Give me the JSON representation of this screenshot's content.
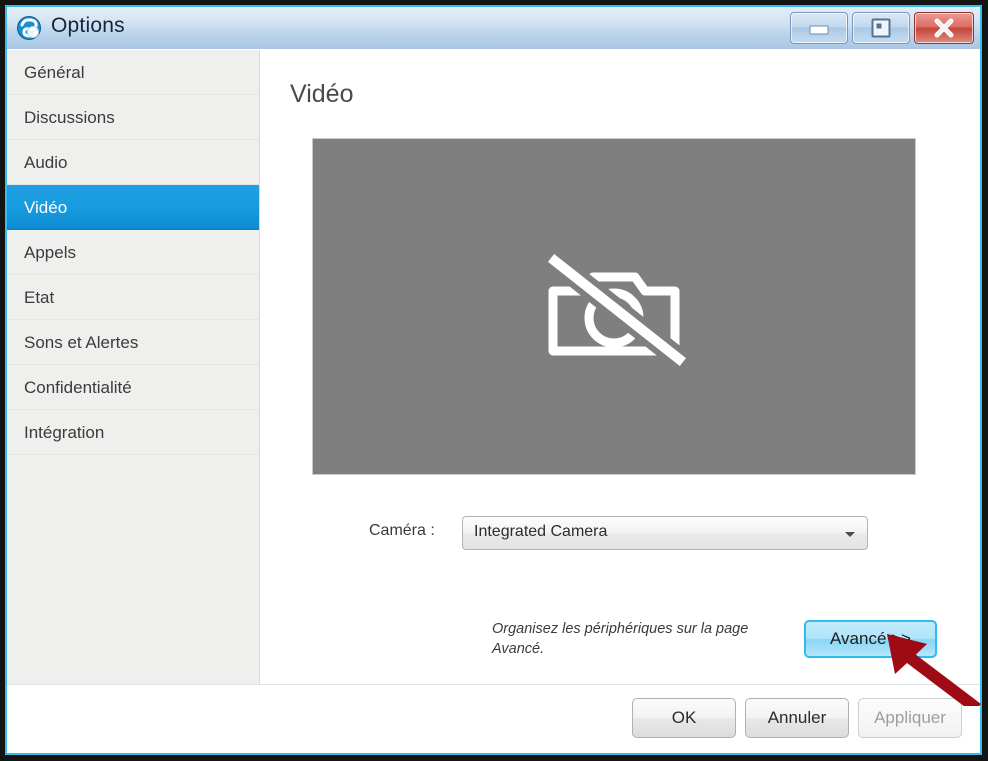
{
  "window": {
    "title": "Options",
    "app_icon": "skype-logo-icon",
    "controls": {
      "minimize": "minimize-button",
      "restore": "restore-button",
      "close": "close-button"
    },
    "frame_color": "#141414",
    "inner_border_color": "#35bdec",
    "titlebar_gradient_top": "#e4eef8",
    "titlebar_gradient_bottom": "#a9c6e4"
  },
  "sidebar": {
    "background": "#efefed",
    "selected_color": "#189bdf",
    "items": [
      {
        "label": "Général",
        "selected": false
      },
      {
        "label": "Discussions",
        "selected": false
      },
      {
        "label": "Audio",
        "selected": false
      },
      {
        "label": "Vidéo",
        "selected": true
      },
      {
        "label": "Appels",
        "selected": false
      },
      {
        "label": "Etat",
        "selected": false
      },
      {
        "label": "Sons et Alertes",
        "selected": false
      },
      {
        "label": "Confidentialité",
        "selected": false
      },
      {
        "label": "Intégration",
        "selected": false
      }
    ]
  },
  "main": {
    "page_title": "Vidéo",
    "preview": {
      "icon": "camera-disabled-icon",
      "background": "#7f7f7f"
    },
    "camera": {
      "label": "Caméra :",
      "value": "Integrated Camera",
      "options": [
        "Integrated Camera"
      ]
    },
    "hint_text": "Organisez les périphériques sur la page Avancé.",
    "advanced_button": "Avancé >>"
  },
  "footer": {
    "ok": "OK",
    "cancel": "Annuler",
    "apply": "Appliquer",
    "apply_disabled": true
  },
  "annotation": {
    "arrow": "red-arrow-pointer",
    "color": "#9e0b14"
  }
}
